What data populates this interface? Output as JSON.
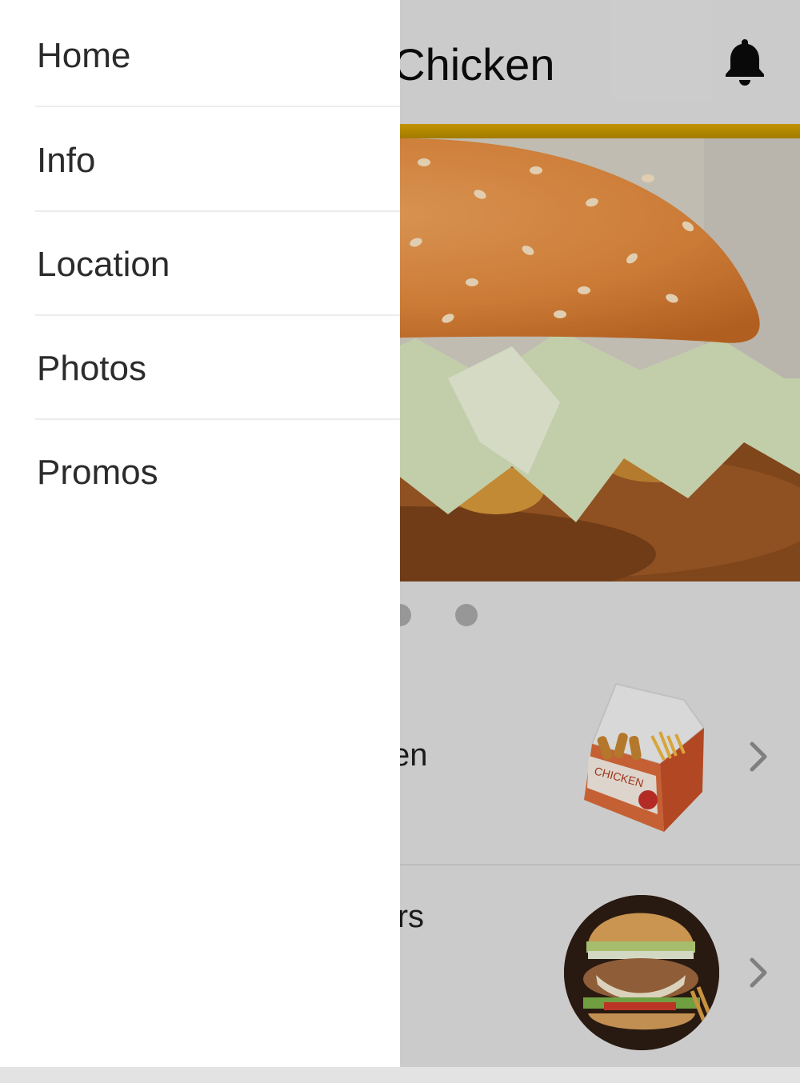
{
  "header": {
    "title": "Fried Chicken",
    "notification_icon": "bell-icon"
  },
  "colors": {
    "accent": "#c99a00",
    "drawer_background": "#ffffff",
    "page_background": "#e3e3e3"
  },
  "carousel": {
    "slide_count": 3,
    "active_index": 0
  },
  "categories": [
    {
      "label": "Chicken",
      "thumbnail_icon": "chicken-box-icon",
      "chevron_icon": "chevron-right-icon"
    },
    {
      "label": "Burgers",
      "thumbnail_icon": "burger-icon",
      "chevron_icon": "chevron-right-icon"
    }
  ],
  "drawer": {
    "items": [
      {
        "label": "Home"
      },
      {
        "label": "Info"
      },
      {
        "label": "Location"
      },
      {
        "label": "Photos"
      },
      {
        "label": "Promos"
      }
    ]
  }
}
